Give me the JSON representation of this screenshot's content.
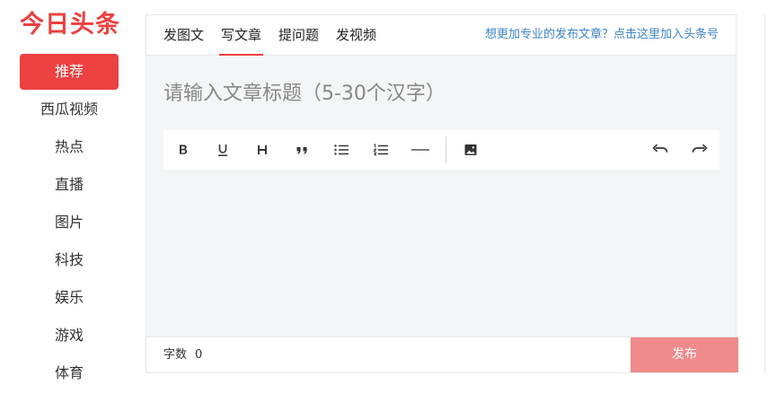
{
  "sidebar": {
    "logo": "今日头条",
    "items": [
      {
        "label": "推荐",
        "active": true
      },
      {
        "label": "西瓜视频"
      },
      {
        "label": "热点"
      },
      {
        "label": "直播"
      },
      {
        "label": "图片"
      },
      {
        "label": "科技"
      },
      {
        "label": "娱乐"
      },
      {
        "label": "游戏"
      },
      {
        "label": "体育"
      }
    ]
  },
  "editor": {
    "tabs": [
      {
        "label": "发图文"
      },
      {
        "label": "写文章",
        "active": true
      },
      {
        "label": "提问题"
      },
      {
        "label": "发视频"
      }
    ],
    "promo_link": "想更加专业的发布文章？点击这里加入头条号",
    "title_placeholder": "请输入文章标题（5-30个汉字）",
    "toolbar": [
      "bold-icon",
      "underline-icon",
      "heading-icon",
      "quote-icon",
      "bullet-list-icon",
      "numbered-list-icon",
      "horizontal-rule-icon",
      "image-icon",
      "undo-icon",
      "redo-icon"
    ],
    "word_count_label": "字数",
    "word_count": "0",
    "publish_label": "发布"
  },
  "colors": {
    "brand_red": "#ed4040",
    "publish_disabled": "#ef8b8b",
    "link_blue": "#3d84c6",
    "editor_bg": "#f4f5f6"
  }
}
